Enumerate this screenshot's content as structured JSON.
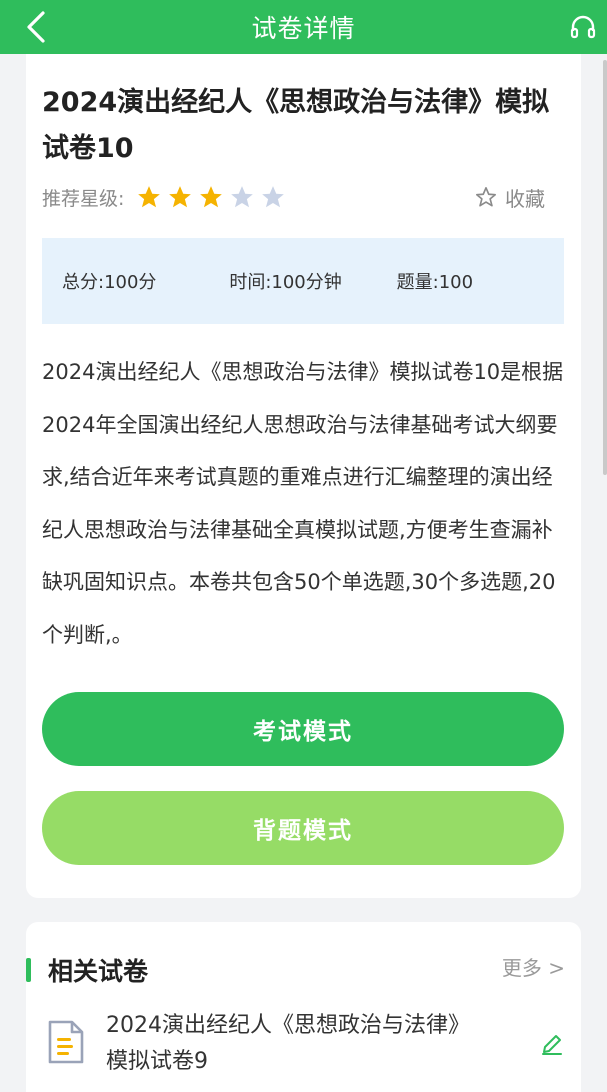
{
  "header": {
    "title": "试卷详情",
    "back_icon": "chevron-left-icon",
    "right_icon": "headset-icon",
    "color": "#2fbd5c"
  },
  "paper": {
    "title": "2024演出经纪人《思想政治与法律》模拟试卷10",
    "rating_label": "推荐星级:",
    "rating": 3,
    "rating_max": 5,
    "favorite_label": "收藏",
    "info": {
      "total_score": "总分:100分",
      "time": "时间:100分钟",
      "question_count": "题量:100"
    },
    "description": "2024演出经纪人《思想政治与法律》模拟试卷10是根据2024年全国演出经纪人思想政治与法律基础考试大纲要求,结合近年来考试真题的重难点进行汇编整理的演出经纪人思想政治与法律基础全真模拟试题,方便考生查漏补缺巩固知识点。本卷共包含50个单选题,30个多选题,20个判断,。"
  },
  "buttons": {
    "exam_mode": "考试模式",
    "recite_mode": "背题模式"
  },
  "related": {
    "title": "相关试卷",
    "more_label": "更多 >",
    "items": [
      {
        "title": "2024演出经纪人《思想政治与法律》模拟试卷9",
        "icon": "document-icon",
        "action_icon": "pencil-icon"
      }
    ]
  },
  "colors": {
    "primary": "#2fbd5c",
    "secondary": "#96dc66",
    "star_active": "#f5b301",
    "star_inactive": "#c9d3e6",
    "info_bg": "#e6f2fc"
  }
}
